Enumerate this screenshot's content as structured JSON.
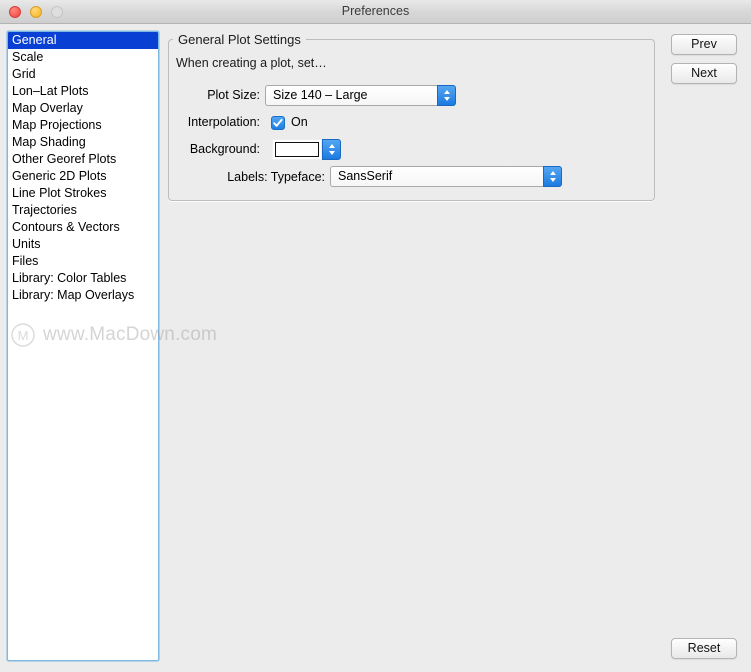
{
  "window": {
    "title": "Preferences",
    "controls": [
      {
        "name": "close",
        "color": "#f5534a",
        "enabled": true
      },
      {
        "name": "minimize",
        "color": "#f7bc34",
        "enabled": true
      },
      {
        "name": "zoom",
        "color": "#dedede",
        "enabled": false
      }
    ]
  },
  "sidebar": {
    "selected_index": 0,
    "selection_color": "#0a3fd4",
    "items": [
      {
        "label": "General"
      },
      {
        "label": "Scale"
      },
      {
        "label": "Grid"
      },
      {
        "label": "Lon–Lat Plots"
      },
      {
        "label": "Map Overlay"
      },
      {
        "label": "Map Projections"
      },
      {
        "label": "Map Shading"
      },
      {
        "label": "Other Georef Plots"
      },
      {
        "label": "Generic 2D Plots"
      },
      {
        "label": "Line Plot Strokes"
      },
      {
        "label": "Trajectories"
      },
      {
        "label": "Contours & Vectors"
      },
      {
        "label": "Units"
      },
      {
        "label": "Files"
      },
      {
        "label": "Library: Color Tables"
      },
      {
        "label": "Library: Map Overlays"
      }
    ]
  },
  "panel": {
    "group_title": "General Plot Settings",
    "intro": "When creating a plot, set…",
    "fields": {
      "plot_size": {
        "label": "Plot Size:",
        "value": "Size 140 – Large"
      },
      "interpolation": {
        "label": "Interpolation:",
        "checked_label": "On",
        "checked": true
      },
      "background": {
        "label": "Background:",
        "swatch_color": "#ffffff"
      },
      "typeface": {
        "label": "Labels: Typeface:",
        "value": "SansSerif"
      }
    }
  },
  "buttons": {
    "prev": "Prev",
    "next": "Next",
    "reset": "Reset"
  },
  "watermark": {
    "text": "www.MacDown.com",
    "logo_letter": "M"
  }
}
